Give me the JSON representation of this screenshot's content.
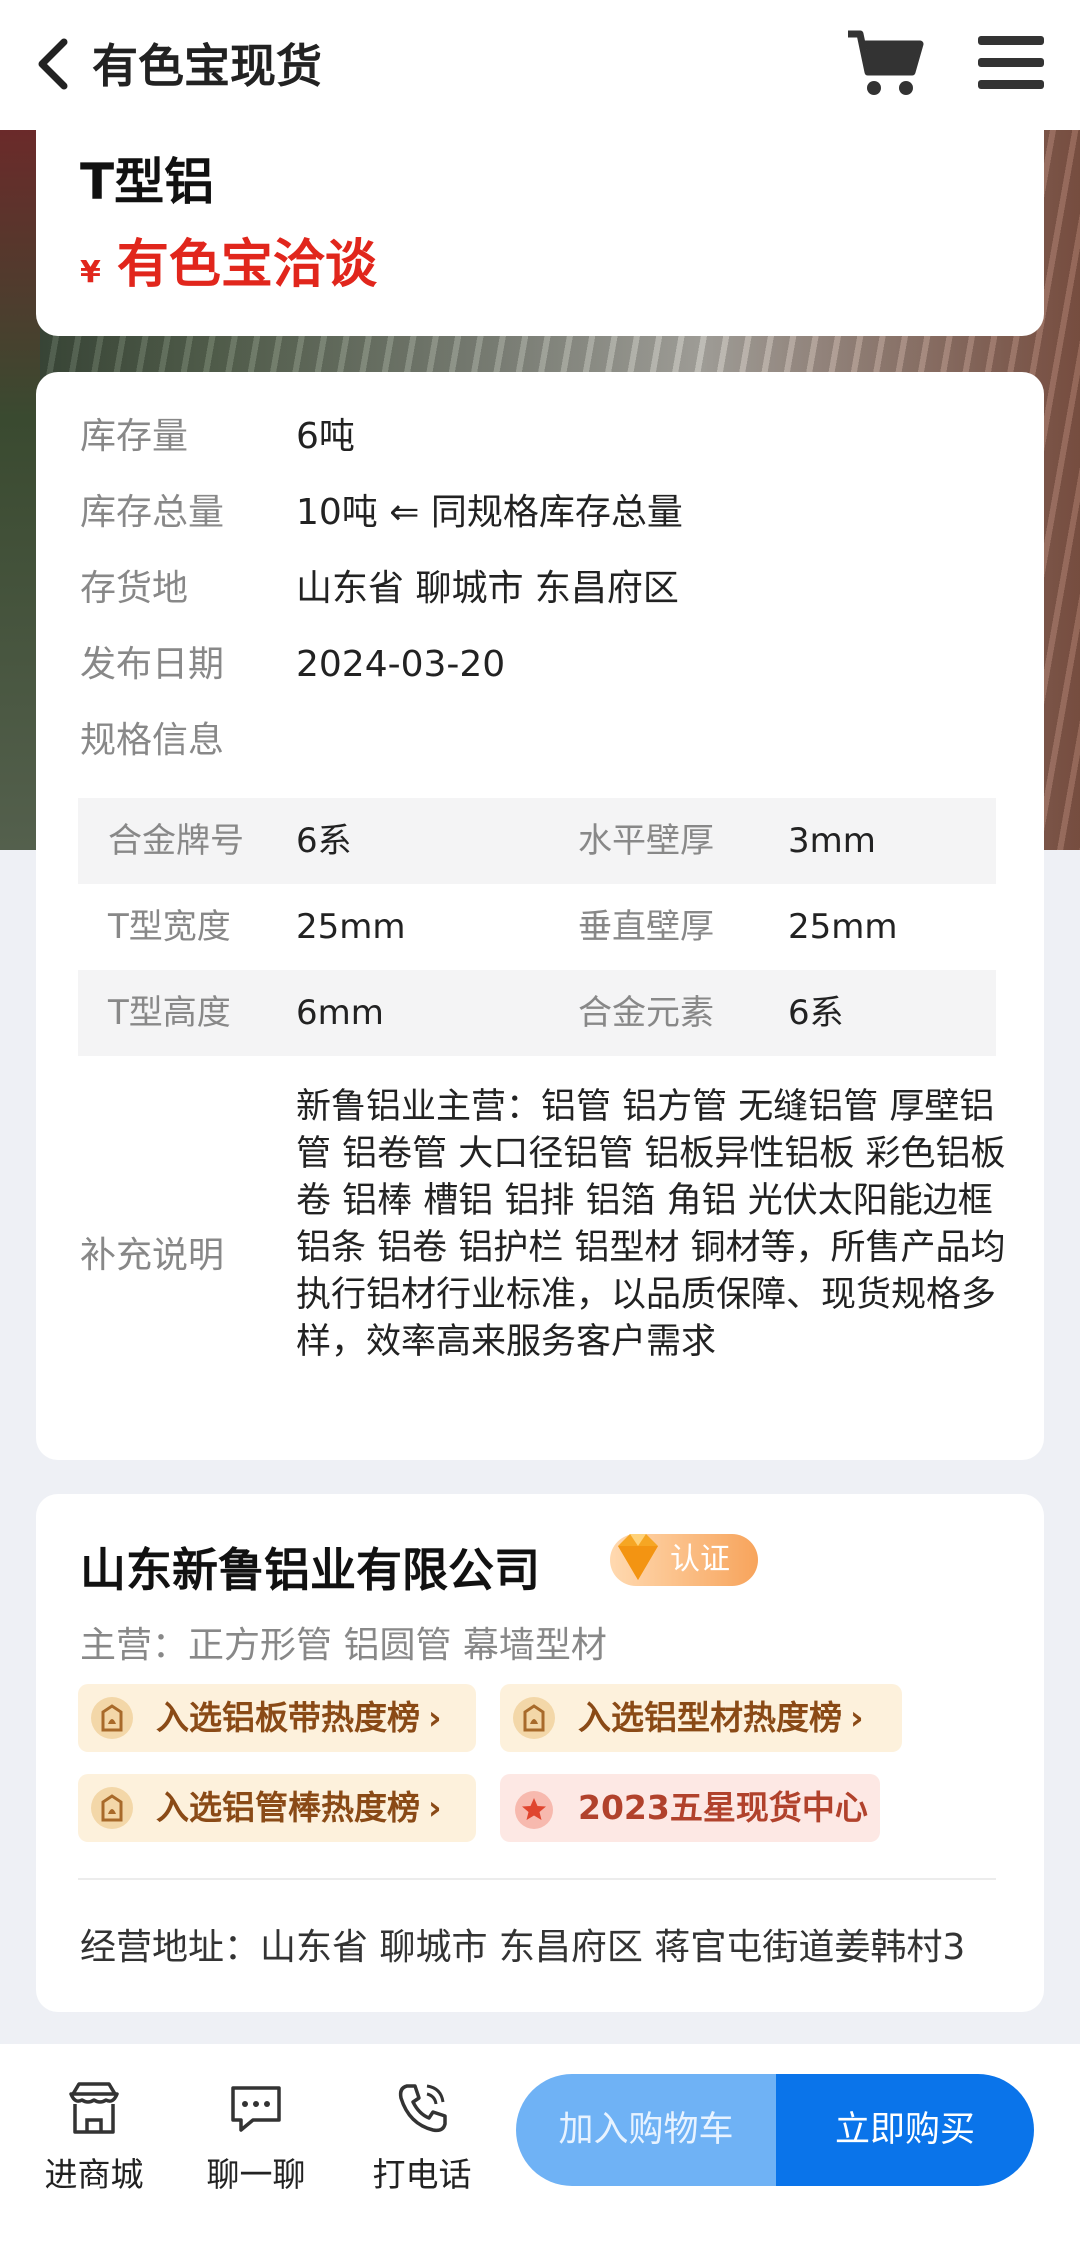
{
  "header": {
    "title": "有色宝现货",
    "back_icon": "back-arrow-icon",
    "cart_icon": "cart-icon",
    "menu_icon": "menu-icon"
  },
  "product": {
    "name": "T型铝",
    "currency": "¥",
    "price_text": "有色宝洽谈"
  },
  "info": {
    "stock_label": "库存量",
    "stock_value": "6吨",
    "total_label": "库存总量",
    "total_value": "10吨 ⇐ 同规格库存总量",
    "location_label": "存货地",
    "location_value": "山东省 聊城市 东昌府区",
    "date_label": "发布日期",
    "date_value": "2024-03-20",
    "spec_label": "规格信息"
  },
  "specs": [
    {
      "k1": "合金牌号",
      "v1": "6系",
      "k2": "水平壁厚",
      "v2": "3mm"
    },
    {
      "k1": "T型宽度",
      "v1": "25mm",
      "k2": "垂直壁厚",
      "v2": "25mm"
    },
    {
      "k1": "T型高度",
      "v1": "6mm",
      "k2": "合金元素",
      "v2": "6系"
    }
  ],
  "note": {
    "label": "补充说明",
    "text": "新鲁铝业主营：铝管 铝方管 无缝铝管 厚壁铝管 铝卷管 大口径铝管 铝板异性铝板 彩色铝板卷 铝棒 槽铝 铝排 铝箔 角铝 光伏太阳能边框 铝条 铝卷 铝护栏 铝型材 铜材等，所售产品均执行铝材行业标准，以品质保障、现货规格多样，效率高来服务客户需求"
  },
  "company": {
    "name": "山东新鲁铝业有限公司",
    "cert": "认证",
    "main_business": "主营：正方形管  铝圆管  幕墙型材",
    "tags": [
      "入选铝板带热度榜",
      "入选铝型材热度榜",
      "入选铝管棒热度榜",
      "2023五星现货中心"
    ],
    "address": "经营地址：山东省 聊城市 东昌府区 蒋官屯街道姜韩村3"
  },
  "bottom": {
    "shop": "进商城",
    "chat": "聊一聊",
    "call": "打电话",
    "add_cart": "加入购物车",
    "buy_now": "立即购买"
  },
  "colors": {
    "accent": "#0a74ea",
    "price": "#e1261c",
    "cart_button": "#6fb2f5"
  }
}
